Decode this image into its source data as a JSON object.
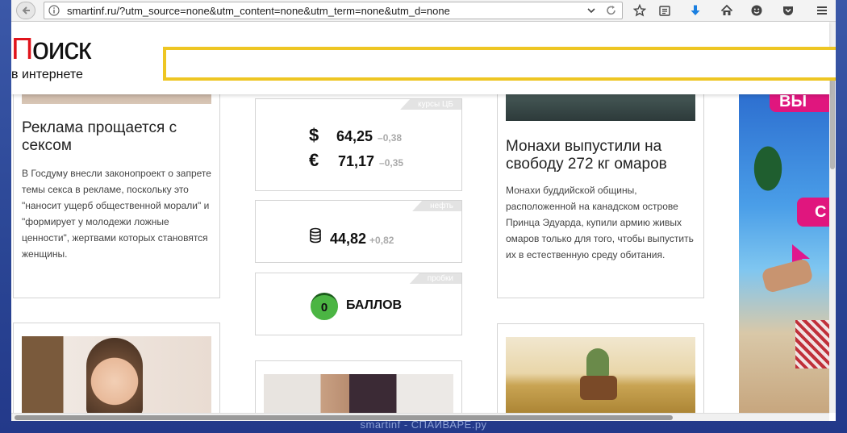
{
  "browser": {
    "url": "smartinf.ru/?utm_source=none&utm_content=none&utm_term=none&utm_d=none"
  },
  "site": {
    "logo_first_letter": "П",
    "logo_rest": "оиск",
    "logo_subtitle": "в интернете"
  },
  "articles": {
    "left": {
      "title": "Реклама прощается с сексом",
      "text": "В Госдуму внесли законопроект о запрете темы секса в рекламе, поскольку это \"наносит ущерб общественной морали\" и \"формирует у молодежи ложные ценности\", жертвами которых становятся женщины."
    },
    "right": {
      "title": "Монахи выпустили на свободу 272 кг омаров",
      "text": "Монахи буддийской общины, расположенной на канадском острове Принца Эдуарда, купили армию живых омаров только для того, чтобы выпустить их в естественную среду обитания."
    }
  },
  "widgets": {
    "rates": {
      "tag": "курсы ЦБ",
      "usd_symbol": "$",
      "usd_value": "64,25",
      "usd_change": "–0,38",
      "eur_symbol": "€",
      "eur_value": "71,17",
      "eur_change": "–0,35"
    },
    "oil": {
      "tag": "нефть",
      "value": "44,82",
      "change": "+0,82"
    },
    "traffic": {
      "tag": "пробки",
      "score": "0",
      "label": "БАЛЛОВ"
    }
  },
  "ad": {
    "visible_text_top": "ВЫ",
    "visible_text_mid": "С"
  },
  "watermark": "smartinf - СПАЙВАРЕ.ру",
  "colors": {
    "logo_red": "#e0141c",
    "search_border": "#eec623",
    "traffic_green": "#4bb543",
    "ad_pink": "#e0167e"
  }
}
